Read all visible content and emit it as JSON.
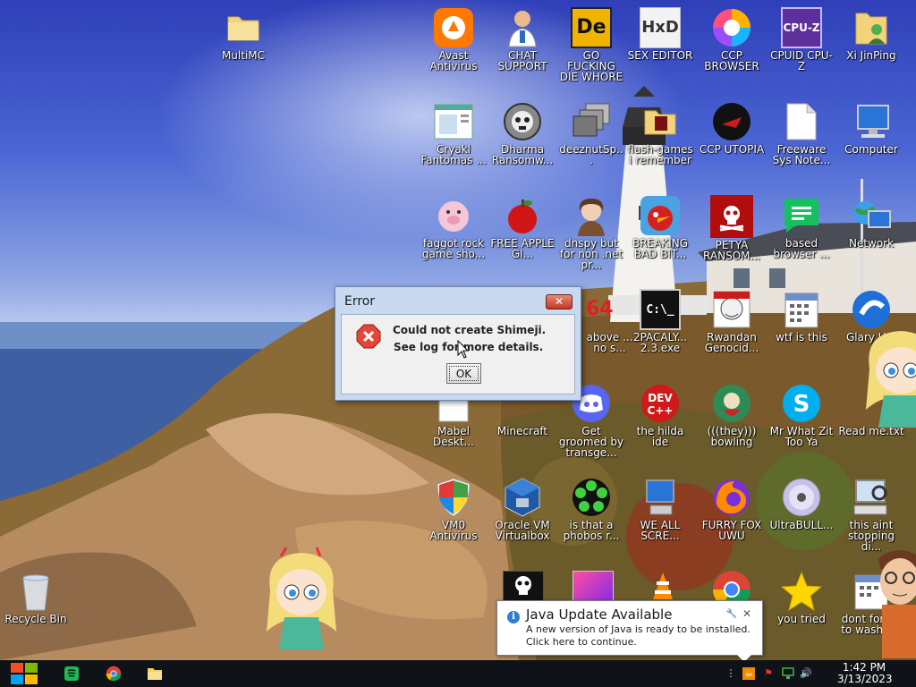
{
  "desktop": {
    "icons": [
      {
        "label": "MultiMC",
        "icon": "folder-icon"
      },
      {
        "label": "Avast Antivirus",
        "icon": "avast-icon"
      },
      {
        "label": "CHAT SUPPORT",
        "icon": "support-agent-icon"
      },
      {
        "label": "GO FUCKING DIE WHORE",
        "icon": "de-logo-icon"
      },
      {
        "label": "SEX EDITOR",
        "icon": "hxd-icon"
      },
      {
        "label": "CCP BROWSER",
        "icon": "browser-icon"
      },
      {
        "label": "CPUID CPU-Z",
        "icon": "cpuz-icon"
      },
      {
        "label": "Xi JinPing",
        "icon": "user-folder-icon"
      },
      {
        "label": "Cryakl Fantomas ...",
        "icon": "window-app-icon"
      },
      {
        "label": "Dharma Ransomw...",
        "icon": "skull-disc-icon"
      },
      {
        "label": "deeznutSp...",
        "icon": "stack-windows-icon"
      },
      {
        "label": "flash-games i remember",
        "icon": "folder-icon"
      },
      {
        "label": "CCP UTOPIA",
        "icon": "dark-disc-icon"
      },
      {
        "label": "Freeware Sys Note...",
        "icon": "document-icon"
      },
      {
        "label": "Computer",
        "icon": "computer-icon"
      },
      {
        "label": "faggot rock game sho...",
        "icon": "pig-icon"
      },
      {
        "label": "FREE APPLE GI...",
        "icon": "apple-icon"
      },
      {
        "label": "dnspy but for non .net pr...",
        "icon": "portrait-icon"
      },
      {
        "label": "BREAKING BAD BIT...",
        "icon": "angry-bird-icon"
      },
      {
        "label": "PETYA RANSOM...",
        "icon": "skull-red-icon"
      },
      {
        "label": "based browser ...",
        "icon": "chat-green-icon"
      },
      {
        "label": "Network",
        "icon": "network-icon"
      },
      {
        "label": "above ... no s...",
        "icon": "x64-icon"
      },
      {
        "label": "2PACALY... 2.3.exe",
        "icon": "terminal-icon"
      },
      {
        "label": "Rwandan Genocid...",
        "icon": "meme-face-icon"
      },
      {
        "label": "wtf is this",
        "icon": "calendar-icon"
      },
      {
        "label": "Glary U...",
        "icon": "glary-icon"
      },
      {
        "label": "Mabel Deskt...",
        "icon": "document-icon"
      },
      {
        "label": "Minecraft",
        "icon": "minecraft-icon"
      },
      {
        "label": "Get groomed by transge...",
        "icon": "discord-icon"
      },
      {
        "label": "the hilda ide",
        "icon": "devcpp-icon"
      },
      {
        "label": "(((they))) bowling",
        "icon": "bowling-icon"
      },
      {
        "label": "Mr What Zit Too Ya",
        "icon": "skype-icon"
      },
      {
        "label": "Read me.txt",
        "icon": "text-file-icon"
      },
      {
        "label": "VM0 Antivirus",
        "icon": "shield-icon"
      },
      {
        "label": "Oracle VM Virtualbox",
        "icon": "virtualbox-icon"
      },
      {
        "label": "is that a phobos r...",
        "icon": "icq-flower-icon"
      },
      {
        "label": "WE ALL SCRE...",
        "icon": "computer-icon"
      },
      {
        "label": "FURRY FOX UWU",
        "icon": "firefox-icon"
      },
      {
        "label": "UltraBULL...",
        "icon": "disc-icon"
      },
      {
        "label": "this aint stopping di...",
        "icon": "computer-search-icon"
      },
      {
        "label": "Recycle Bin",
        "icon": "recycle-bin-icon"
      },
      {
        "label": "you tried",
        "icon": "star-icon"
      },
      {
        "label": "dont forg... to wash y...",
        "icon": "calendar-icon"
      }
    ]
  },
  "error_dialog": {
    "title": "Error",
    "close_label": "✕",
    "message_line1": "Could not create Shimeji.",
    "message_line2": "See log for more details.",
    "ok_label": "OK"
  },
  "java_notification": {
    "title": "Java Update Available",
    "line1": "A new version of Java is ready to be installed.",
    "line2": "Click here to continue."
  },
  "taskbar": {
    "clock_time": "1:42 PM",
    "clock_date": "3/13/2023",
    "pinned": [
      "spotify-icon",
      "chrome-icon",
      "file-explorer-icon"
    ]
  },
  "colors": {
    "taskbar_bg": "#0f1216",
    "dialog_frame": "#c9daf0",
    "close_red": "#c5361f",
    "windows_logo": [
      "#f25022",
      "#7fba00",
      "#00a4ef",
      "#ffb900"
    ]
  }
}
